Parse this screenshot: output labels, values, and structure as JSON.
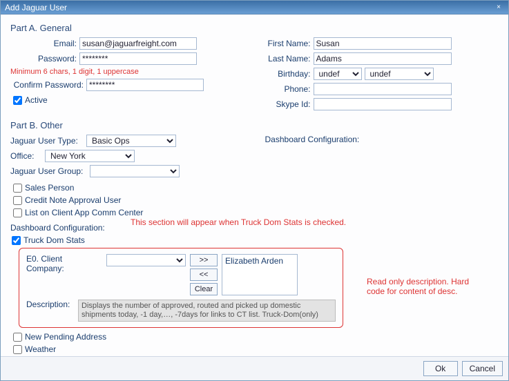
{
  "window": {
    "title": "Add Jaguar User",
    "close_label": "×"
  },
  "partA": {
    "heading": "Part A. General",
    "email_label": "Email:",
    "email_value": "susan@jaguarfreight.com",
    "password_label": "Password:",
    "password_value": "********",
    "password_hint": "Minimum 6 chars, 1 digit, 1 uppercase",
    "confirm_label": "Confirm Password:",
    "confirm_value": "********",
    "active_label": "Active",
    "active_checked": true,
    "first_name_label": "First Name:",
    "first_name_value": "Susan",
    "last_name_label": "Last Name:",
    "last_name_value": "Adams",
    "birthday_label": "Birthday:",
    "birthday_month": "undef",
    "birthday_day": "undef",
    "phone_label": "Phone:",
    "phone_value": "",
    "skype_label": "Skype Id:",
    "skype_value": ""
  },
  "partB": {
    "heading": "Part B. Other",
    "user_type_label": "Jaguar User Type:",
    "user_type_value": "Basic Ops",
    "office_label": "Office:",
    "office_value": "New York",
    "user_group_label": "Jaguar User Group:",
    "user_group_value": "",
    "dashboard_config_label": "Dashboard Configuration:",
    "sales_person_label": "Sales Person",
    "credit_note_label": "Credit Note Approval User",
    "list_comm_label": "List on Client App Comm Center"
  },
  "dashboard": {
    "section_label": "Dashboard Configuration:",
    "truck_dom_label": "Truck Dom Stats",
    "truck_dom_checked": true,
    "client_company_label": "E0. Client Company:",
    "move_right": ">>",
    "move_left": "<<",
    "clear_label": "Clear",
    "selected_item": "Elizabeth Arden",
    "description_label": "Description:",
    "description_value": "Displays the number of approved, routed and picked up domestic shipments today, -1 day,…, -7days for links to CT list. Truck-Dom(only)",
    "new_pending_label": "New Pending Address",
    "weather_label": "Weather"
  },
  "annotations": {
    "appear_note": "This section will appear when Truck Dom Stats is checked.",
    "readonly_note": "Read only description. Hard code for content of desc."
  },
  "footer": {
    "ok_label": "Ok",
    "cancel_label": "Cancel"
  }
}
